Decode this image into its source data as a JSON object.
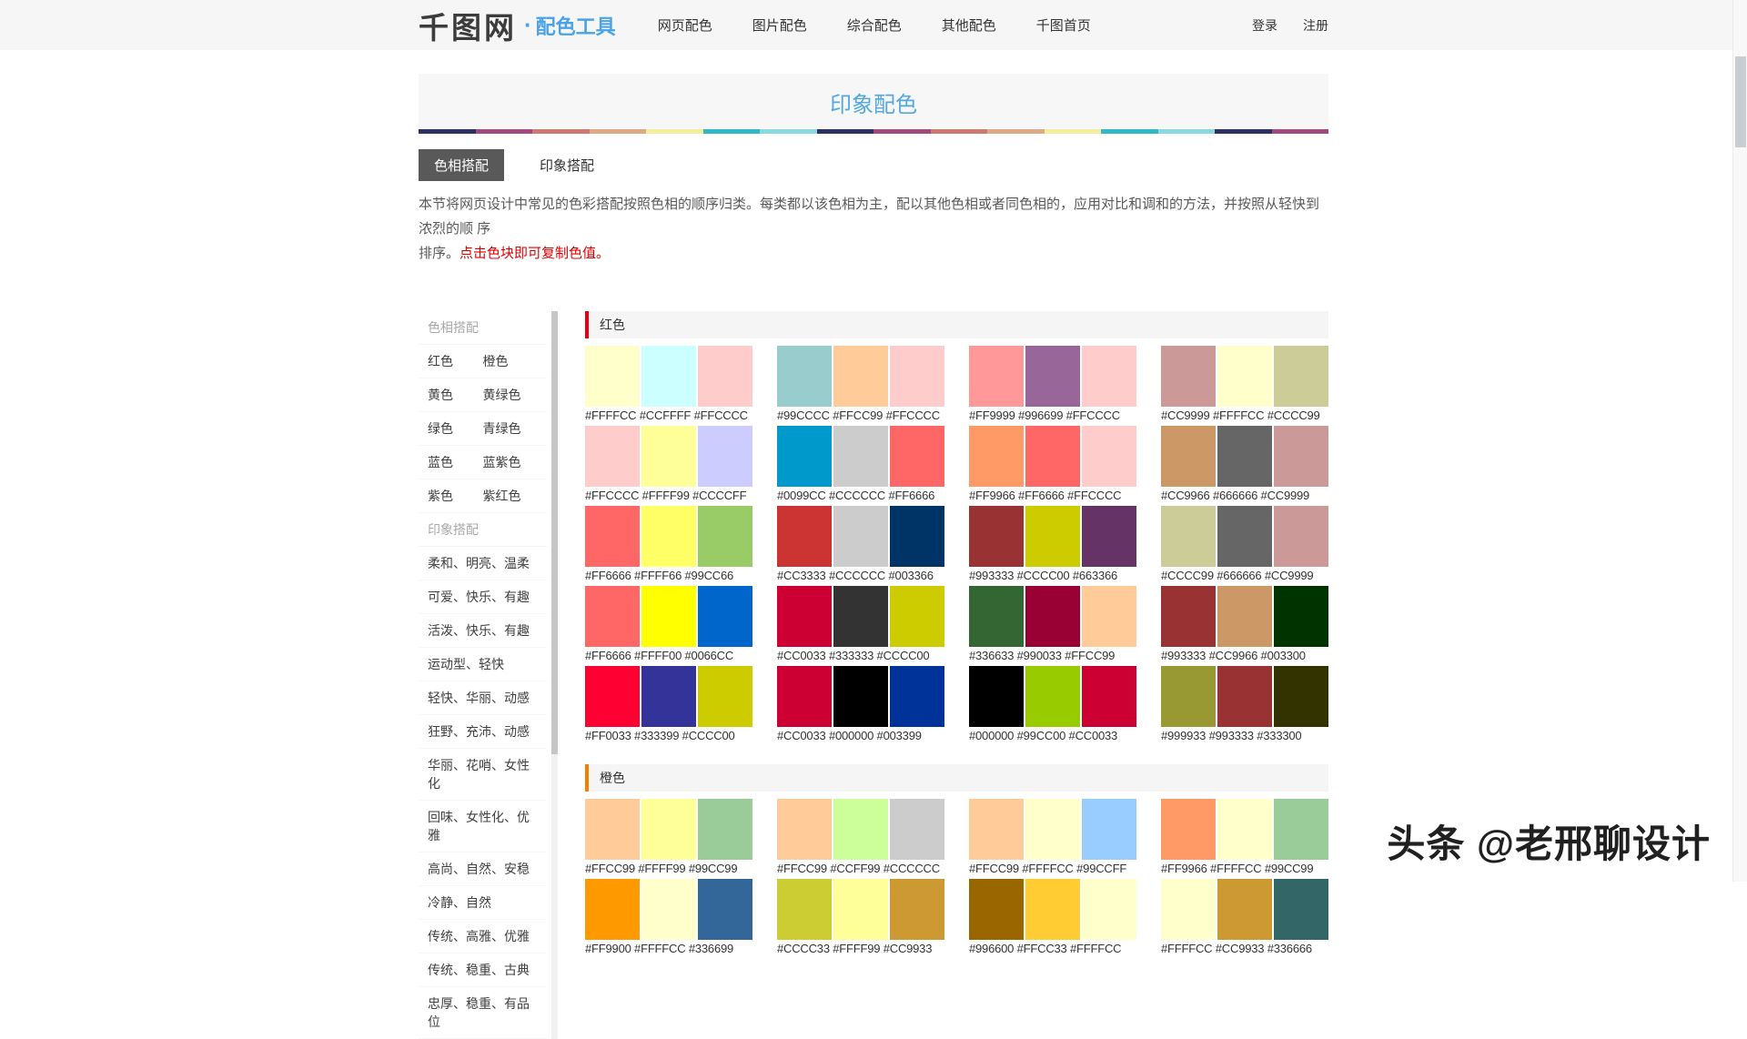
{
  "nav": {
    "logo": "千图网",
    "logo_dot": "·",
    "brand": "配色工具",
    "items": [
      "网页配色",
      "图片配色",
      "综合配色",
      "其他配色",
      "千图首页"
    ],
    "login": "登录",
    "register": "注册"
  },
  "header": {
    "title": "印象配色",
    "divider_colors": [
      "#2d3164",
      "#a34a7d",
      "#cd7b72",
      "#dcab85",
      "#f3ee9d",
      "#31b7c5",
      "#8ad8e0"
    ]
  },
  "tabs": [
    {
      "label": "色相搭配",
      "active": true
    },
    {
      "label": "印象搭配",
      "active": false
    }
  ],
  "description": {
    "line1": "本节将网页设计中常见的色彩搭配按照色相的顺序归类。每类都以该色相为主，配以其他色相或者同色相的，应用对比和调和的方法，并按照从轻快到浓烈的顺 序",
    "line2_prefix": "排序。",
    "line2_red": "点击色块即可复制色值。"
  },
  "sidebar": {
    "sections": [
      {
        "header": "色相搭配",
        "rows": [
          [
            "红色",
            "橙色"
          ],
          [
            "黄色",
            "黄绿色"
          ],
          [
            "绿色",
            "青绿色"
          ],
          [
            "蓝色",
            "蓝紫色"
          ],
          [
            "紫色",
            "紫红色"
          ]
        ]
      },
      {
        "header": "印象搭配",
        "rows": [
          [
            "柔和、明亮、温柔"
          ],
          [
            "可爱、快乐、有趣"
          ],
          [
            "活泼、快乐、有趣"
          ],
          [
            "运动型、轻快"
          ],
          [
            "轻快、华丽、动感"
          ],
          [
            "狂野、充沛、动感"
          ],
          [
            "华丽、花哨、女性化"
          ],
          [
            "回味、女性化、优雅"
          ],
          [
            "高尚、自然、安稳"
          ],
          [
            "冷静、自然"
          ],
          [
            "传统、高雅、优雅"
          ],
          [
            "传统、稳重、古典"
          ],
          [
            "忠厚、稳重、有品位"
          ]
        ]
      }
    ]
  },
  "sections": [
    {
      "title": "红色",
      "accent": "#e60012",
      "rows": [
        [
          [
            "#FFFFCC",
            "#CCFFFF",
            "#FFCCCC"
          ],
          [
            "#99CCCC",
            "#FFCC99",
            "#FFCCCC"
          ],
          [
            "#FF9999",
            "#996699",
            "#FFCCCC"
          ],
          [
            "#CC9999",
            "#FFFFCC",
            "#CCCC99"
          ]
        ],
        [
          [
            "#FFCCCC",
            "#FFFF99",
            "#CCCCFF"
          ],
          [
            "#0099CC",
            "#CCCCCC",
            "#FF6666"
          ],
          [
            "#FF9966",
            "#FF6666",
            "#FFCCCC"
          ],
          [
            "#CC9966",
            "#666666",
            "#CC9999"
          ]
        ],
        [
          [
            "#FF6666",
            "#FFFF66",
            "#99CC66"
          ],
          [
            "#CC3333",
            "#CCCCCC",
            "#003366"
          ],
          [
            "#993333",
            "#CCCC00",
            "#663366"
          ],
          [
            "#CCCC99",
            "#666666",
            "#CC9999"
          ]
        ],
        [
          [
            "#FF6666",
            "#FFFF00",
            "#0066CC"
          ],
          [
            "#CC0033",
            "#333333",
            "#CCCC00"
          ],
          [
            "#336633",
            "#990033",
            "#FFCC99"
          ],
          [
            "#993333",
            "#CC9966",
            "#003300"
          ]
        ],
        [
          [
            "#FF0033",
            "#333399",
            "#CCCC00"
          ],
          [
            "#CC0033",
            "#000000",
            "#003399"
          ],
          [
            "#000000",
            "#99CC00",
            "#CC0033"
          ],
          [
            "#999933",
            "#993333",
            "#333300"
          ]
        ]
      ]
    },
    {
      "title": "橙色",
      "accent": "#f08200",
      "rows": [
        [
          [
            "#FFCC99",
            "#FFFF99",
            "#99CC99"
          ],
          [
            "#FFCC99",
            "#CCFF99",
            "#CCCCCC"
          ],
          [
            "#FFCC99",
            "#FFFFCC",
            "#99CCFF"
          ],
          [
            "#FF9966",
            "#FFFFCC",
            "#99CC99"
          ]
        ],
        [
          [
            "#FF9900",
            "#FFFFCC",
            "#336699"
          ],
          [
            "#CCCC33",
            "#FFFF99",
            "#CC9933"
          ],
          [
            "#996600",
            "#FFCC33",
            "#FFFFCC"
          ],
          [
            "#FFFFCC",
            "#CC9933",
            "#336666"
          ]
        ]
      ]
    }
  ],
  "watermark": "头条 @老邢聊设计"
}
